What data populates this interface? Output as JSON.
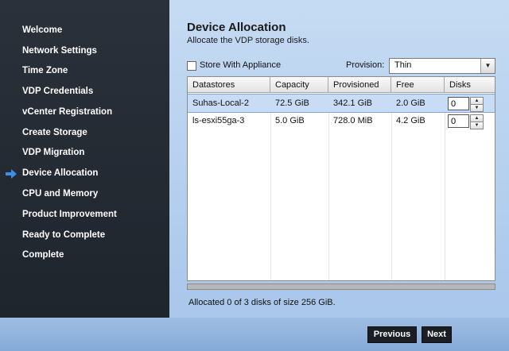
{
  "sidebar": {
    "items": [
      {
        "label": "Welcome"
      },
      {
        "label": "Network Settings"
      },
      {
        "label": "Time Zone"
      },
      {
        "label": "VDP Credentials"
      },
      {
        "label": "vCenter Registration"
      },
      {
        "label": "Create Storage"
      },
      {
        "label": "VDP Migration"
      },
      {
        "label": "Device Allocation",
        "current": true
      },
      {
        "label": "CPU and Memory"
      },
      {
        "label": "Product Improvement"
      },
      {
        "label": "Ready to Complete"
      },
      {
        "label": "Complete"
      }
    ],
    "current_icon": "arrow-right-icon",
    "arrow_color": "#3c8fe6"
  },
  "page": {
    "title": "Device Allocation",
    "subtitle": "Allocate the VDP storage disks."
  },
  "options": {
    "store_with_appliance_label": "Store With Appliance",
    "store_with_appliance_checked": false,
    "provision_label": "Provision:",
    "provision_value": "Thin"
  },
  "table": {
    "headers": [
      "Datastores",
      "Capacity",
      "Provisioned",
      "Free",
      "Disks"
    ],
    "rows": [
      {
        "datastore": "Suhas-Local-2",
        "capacity": "72.5 GiB",
        "provisioned": "342.1 GiB",
        "free": "2.0 GiB",
        "disks": "0"
      },
      {
        "datastore": "ls-esxi55ga-3",
        "capacity": "5.0 GiB",
        "provisioned": "728.0 MiB",
        "free": "4.2 GiB",
        "disks": "0"
      }
    ]
  },
  "summary": "Allocated 0 of 3 disks of size 256 GiB.",
  "footer": {
    "previous_label": "Previous",
    "next_label": "Next"
  }
}
